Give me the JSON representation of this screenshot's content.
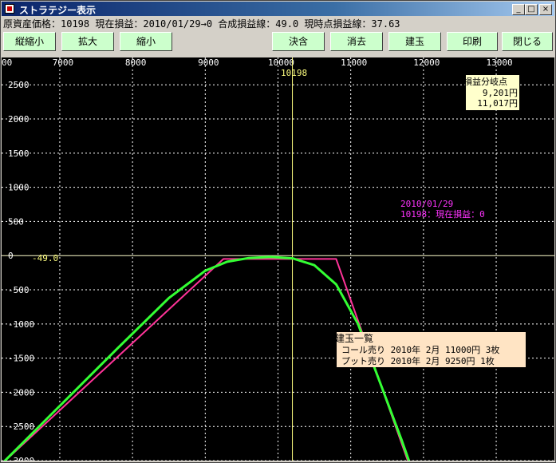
{
  "window": {
    "title": "ストラテジー表示",
    "controls": {
      "minimize": "_",
      "maximize": "□",
      "close": "×"
    }
  },
  "status_line": "原資産価格：10198 現在損益：2010/01/29→0 合成損益線：49.0 現時点損益線：37.63",
  "toolbar": {
    "zoom_vertical": "縦縮小",
    "zoom_in": "拡大",
    "zoom_out": "縮小",
    "settle": "決含",
    "erase": "消去",
    "open_position": "建玉",
    "print": "印刷",
    "close": "閉じる"
  },
  "colors": {
    "background": "#000000",
    "grid": "#ffffff",
    "axis_label": "#ffffff",
    "current_price_line": "#ffff80",
    "expiry_line": "#ff3399",
    "current_line": "#33ff33",
    "info_magenta": "#ff33ff",
    "box_fill": "#ffffcc"
  },
  "chart_data": {
    "type": "line",
    "x_ticks": [
      7000,
      8000,
      9000,
      10000,
      11000,
      12000,
      13000
    ],
    "x_tick_labels": [
      "7000",
      "8000",
      "9000",
      "10000",
      "11000",
      "12000",
      "13000"
    ],
    "y_ticks": [
      2500,
      2000,
      1500,
      1000,
      500,
      0,
      -500,
      -1000,
      -1500,
      -2000,
      -2500,
      -3000
    ],
    "y_tick_labels": [
      "2500",
      "2000",
      "1500",
      "1000",
      "500",
      "0",
      "-500",
      "-1000",
      "-1500",
      "-2000",
      "-2500",
      "-3000"
    ],
    "top_left_label": "00",
    "xlim": [
      6200,
      13800
    ],
    "ylim": [
      -3000,
      2900
    ],
    "current_price": 10198,
    "current_price_label": "10198",
    "zero_line_label": "-49.0",
    "series": [
      {
        "key": "expiry",
        "x": [
          6200,
          9250,
          10800,
          11300,
          11800
        ],
        "y": [
          -3050,
          -49,
          -49,
          -1549,
          -3049
        ]
      },
      {
        "key": "current",
        "x": [
          6200,
          7000,
          7800,
          8500,
          9000,
          9300,
          9600,
          9900,
          10200,
          10500,
          10800,
          11100,
          11400,
          11700,
          11800
        ],
        "y": [
          -3050,
          -2200,
          -1350,
          -620,
          -220,
          -90,
          -35,
          -20,
          -40,
          -140,
          -420,
          -1000,
          -1850,
          -2700,
          -3000
        ]
      }
    ],
    "breakeven_box": {
      "title": "損益分岐点",
      "lines": [
        "9,201円",
        "11,017円"
      ]
    },
    "pnl_info": {
      "date": "2010/01/29",
      "text": "10198：現在損益：0"
    },
    "positions_box": {
      "title": "建玉一覧",
      "rows": [
        "コール売り 2010年 2月 11000円 3枚",
        "プット売り 2010年 2月 9250円 1枚"
      ]
    }
  }
}
